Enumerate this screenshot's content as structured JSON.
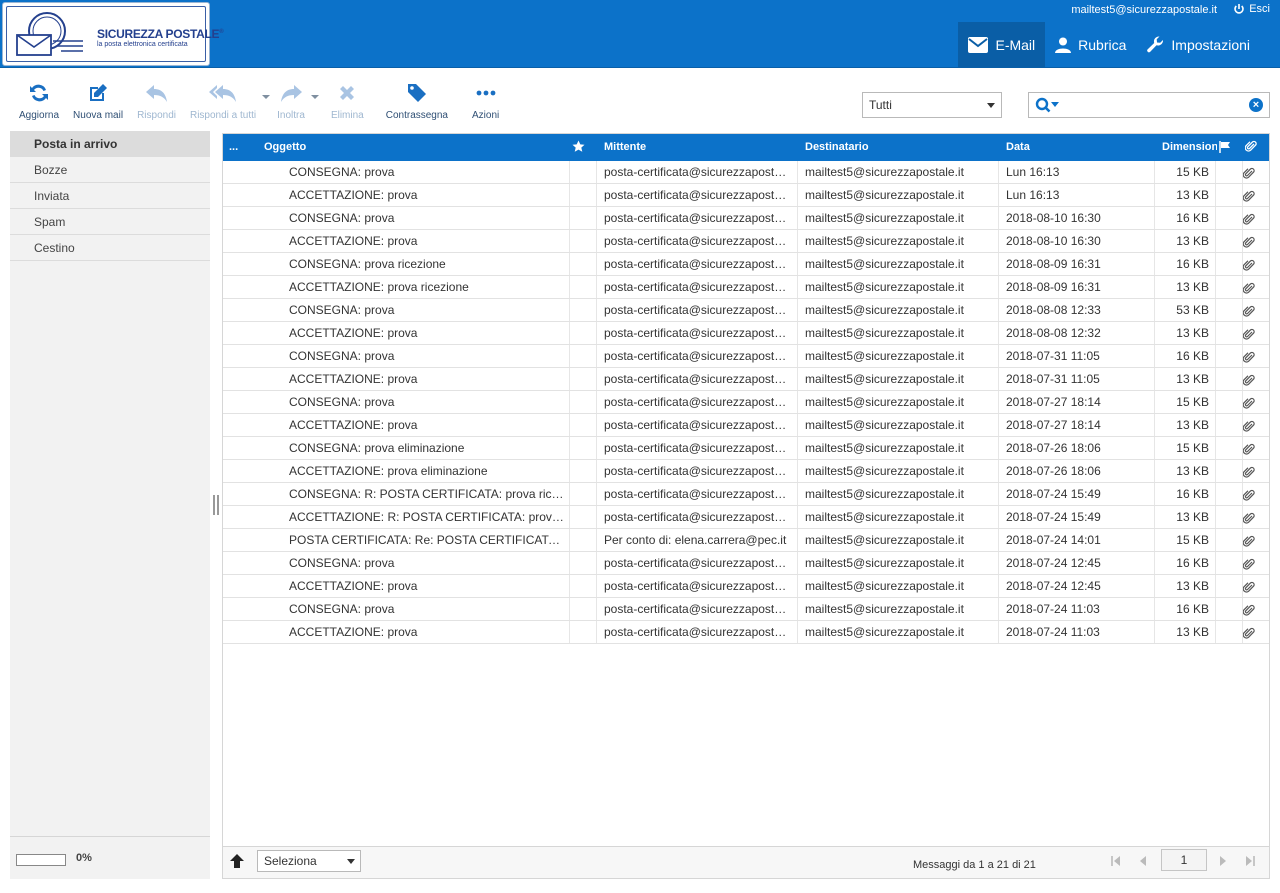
{
  "header": {
    "logo_title": "SICUREZZA POSTALE",
    "logo_registered": "®",
    "logo_subtitle": "la posta elettronica certificata",
    "user_email": "mailtest5@sicurezzapostale.it",
    "logout_label": "Esci",
    "nav": [
      {
        "label": "E-Mail",
        "icon": "envelope-icon",
        "active": true
      },
      {
        "label": "Rubrica",
        "icon": "user-icon",
        "active": false
      },
      {
        "label": "Impostazioni",
        "icon": "wrench-icon",
        "active": false
      }
    ]
  },
  "toolbar": {
    "buttons": [
      {
        "label": "Aggiorna",
        "icon": "refresh-icon",
        "enabled": true
      },
      {
        "label": "Nuova mail",
        "icon": "compose-icon",
        "enabled": true
      },
      {
        "label": "Rispondi",
        "icon": "reply-icon",
        "enabled": false
      },
      {
        "label": "Rispondi a tutti",
        "icon": "reply-all-icon",
        "enabled": false
      },
      {
        "label": "Inoltra",
        "icon": "forward-icon",
        "enabled": false
      },
      {
        "label": "Elimina",
        "icon": "delete-icon",
        "enabled": false
      },
      {
        "label": "Contrassegna",
        "icon": "tag-icon",
        "enabled": true
      },
      {
        "label": "Azioni",
        "icon": "more-icon",
        "enabled": true
      }
    ],
    "filter": {
      "selected": "Tutti"
    },
    "search": {
      "value": "",
      "placeholder": ""
    }
  },
  "sidebar": {
    "folders": [
      {
        "label": "Posta in arrivo",
        "active": true
      },
      {
        "label": "Bozze",
        "active": false
      },
      {
        "label": "Inviata",
        "active": false
      },
      {
        "label": "Spam",
        "active": false
      },
      {
        "label": "Cestino",
        "active": false
      }
    ],
    "quota": {
      "percent_text": "0%",
      "fill_fraction": 0
    }
  },
  "grid": {
    "columns": {
      "more": "...",
      "subject": "Oggetto",
      "sender": "Mittente",
      "recipient": "Destinatario",
      "date": "Data",
      "size": "Dimensione"
    },
    "rows": [
      {
        "subject": "CONSEGNA: prova",
        "from": "posta-certificata@sicurezzapostale.it",
        "to": "mailtest5@sicurezzapostale.it",
        "date": "Lun 16:13",
        "size": "15 KB"
      },
      {
        "subject": "ACCETTAZIONE: prova",
        "from": "posta-certificata@sicurezzapostale.it",
        "to": "mailtest5@sicurezzapostale.it",
        "date": "Lun 16:13",
        "size": "13 KB"
      },
      {
        "subject": "CONSEGNA: prova",
        "from": "posta-certificata@sicurezzapostale.it",
        "to": "mailtest5@sicurezzapostale.it",
        "date": "2018-08-10 16:30",
        "size": "16 KB"
      },
      {
        "subject": "ACCETTAZIONE: prova",
        "from": "posta-certificata@sicurezzapostale.it",
        "to": "mailtest5@sicurezzapostale.it",
        "date": "2018-08-10 16:30",
        "size": "13 KB"
      },
      {
        "subject": "CONSEGNA: prova ricezione",
        "from": "posta-certificata@sicurezzapostale.it",
        "to": "mailtest5@sicurezzapostale.it",
        "date": "2018-08-09 16:31",
        "size": "16 KB"
      },
      {
        "subject": "ACCETTAZIONE: prova ricezione",
        "from": "posta-certificata@sicurezzapostale.it",
        "to": "mailtest5@sicurezzapostale.it",
        "date": "2018-08-09 16:31",
        "size": "13 KB"
      },
      {
        "subject": "CONSEGNA: prova",
        "from": "posta-certificata@sicurezzapostale.it",
        "to": "mailtest5@sicurezzapostale.it",
        "date": "2018-08-08 12:33",
        "size": "53 KB"
      },
      {
        "subject": "ACCETTAZIONE: prova",
        "from": "posta-certificata@sicurezzapostale.it",
        "to": "mailtest5@sicurezzapostale.it",
        "date": "2018-08-08 12:32",
        "size": "13 KB"
      },
      {
        "subject": "CONSEGNA: prova",
        "from": "posta-certificata@sicurezzapostale.it",
        "to": "mailtest5@sicurezzapostale.it",
        "date": "2018-07-31 11:05",
        "size": "16 KB"
      },
      {
        "subject": "ACCETTAZIONE: prova",
        "from": "posta-certificata@sicurezzapostale.it",
        "to": "mailtest5@sicurezzapostale.it",
        "date": "2018-07-31 11:05",
        "size": "13 KB"
      },
      {
        "subject": "CONSEGNA: prova",
        "from": "posta-certificata@sicurezzapostale.it",
        "to": "mailtest5@sicurezzapostale.it",
        "date": "2018-07-27 18:14",
        "size": "15 KB"
      },
      {
        "subject": "ACCETTAZIONE: prova",
        "from": "posta-certificata@sicurezzapostale.it",
        "to": "mailtest5@sicurezzapostale.it",
        "date": "2018-07-27 18:14",
        "size": "13 KB"
      },
      {
        "subject": "CONSEGNA: prova eliminazione",
        "from": "posta-certificata@sicurezzapostale.it",
        "to": "mailtest5@sicurezzapostale.it",
        "date": "2018-07-26 18:06",
        "size": "15 KB"
      },
      {
        "subject": "ACCETTAZIONE: prova eliminazione",
        "from": "posta-certificata@sicurezzapostale.it",
        "to": "mailtest5@sicurezzapostale.it",
        "date": "2018-07-26 18:06",
        "size": "13 KB"
      },
      {
        "subject": "CONSEGNA: R: POSTA CERTIFICATA: prova ricezione",
        "from": "posta-certificata@sicurezzapostale.it",
        "to": "mailtest5@sicurezzapostale.it",
        "date": "2018-07-24 15:49",
        "size": "16 KB"
      },
      {
        "subject": "ACCETTAZIONE: R: POSTA CERTIFICATA: prova ricezione",
        "from": "posta-certificata@sicurezzapostale.it",
        "to": "mailtest5@sicurezzapostale.it",
        "date": "2018-07-24 15:49",
        "size": "13 KB"
      },
      {
        "subject": "POSTA CERTIFICATA: Re: POSTA CERTIFICATA: prova",
        "from": "Per conto di: elena.carrera@pec.it",
        "to": "mailtest5@sicurezzapostale.it",
        "date": "2018-07-24 14:01",
        "size": "15 KB"
      },
      {
        "subject": "CONSEGNA: prova",
        "from": "posta-certificata@sicurezzapostale.it",
        "to": "mailtest5@sicurezzapostale.it",
        "date": "2018-07-24 12:45",
        "size": "16 KB"
      },
      {
        "subject": "ACCETTAZIONE: prova",
        "from": "posta-certificata@sicurezzapostale.it",
        "to": "mailtest5@sicurezzapostale.it",
        "date": "2018-07-24 12:45",
        "size": "13 KB"
      },
      {
        "subject": "CONSEGNA: prova",
        "from": "posta-certificata@sicurezzapostale.it",
        "to": "mailtest5@sicurezzapostale.it",
        "date": "2018-07-24 11:03",
        "size": "16 KB"
      },
      {
        "subject": "ACCETTAZIONE: prova",
        "from": "posta-certificata@sicurezzapostale.it",
        "to": "mailtest5@sicurezzapostale.it",
        "date": "2018-07-24 11:03",
        "size": "13 KB"
      }
    ],
    "footer": {
      "select_label": "Seleziona",
      "message_count": "Messaggi da 1 a 21 di 21",
      "page": "1"
    }
  },
  "colors": {
    "brand": "#0c72c9",
    "brand_dark": "#0a5ea6",
    "logo_navy": "#24408e"
  }
}
